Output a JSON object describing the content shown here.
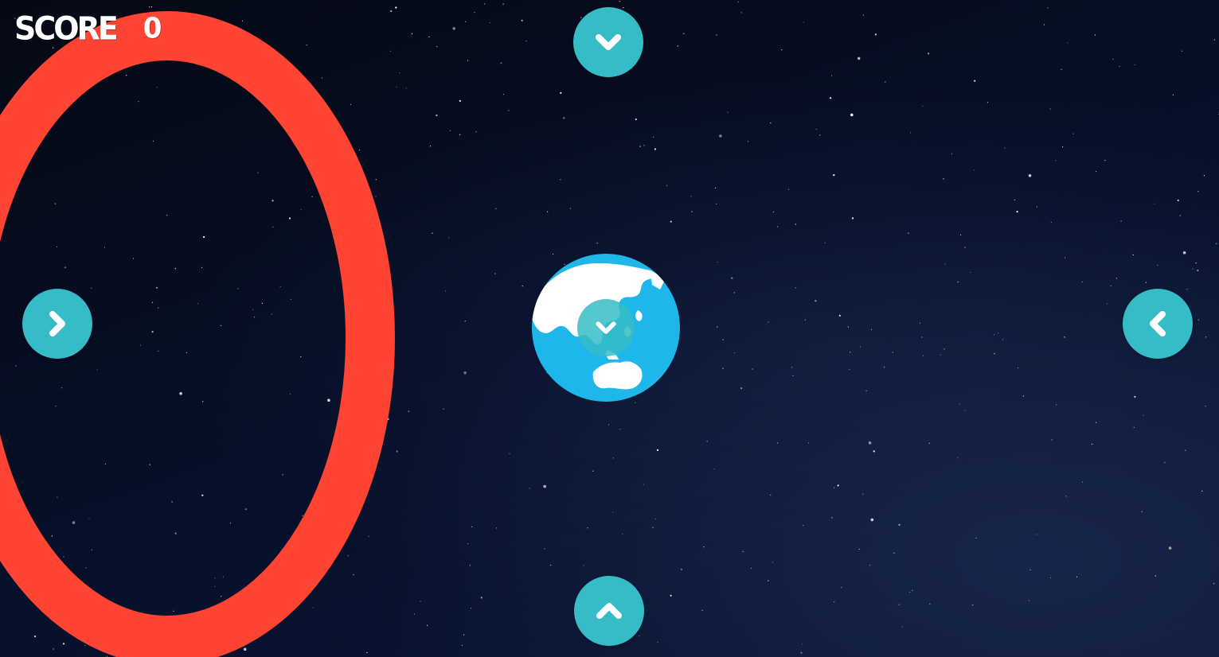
{
  "hud": {
    "score_label": "SCORE",
    "score_value": "0"
  },
  "controls": {
    "top": {
      "icon": "chevron-down-icon",
      "color": "#35bcc6"
    },
    "bottom": {
      "icon": "chevron-up-icon",
      "color": "#35bcc6"
    },
    "left": {
      "icon": "chevron-right-icon",
      "color": "#35bcc6"
    },
    "right": {
      "icon": "chevron-left-icon",
      "color": "#35bcc6"
    },
    "center": {
      "icon": "chevron-down-icon",
      "color": "#35bcc6"
    }
  },
  "colors": {
    "background": "#050b1a",
    "ring": "#ff4433",
    "ocean": "#1fb6ea",
    "land": "#ffffff",
    "button": "#35bcc6"
  }
}
